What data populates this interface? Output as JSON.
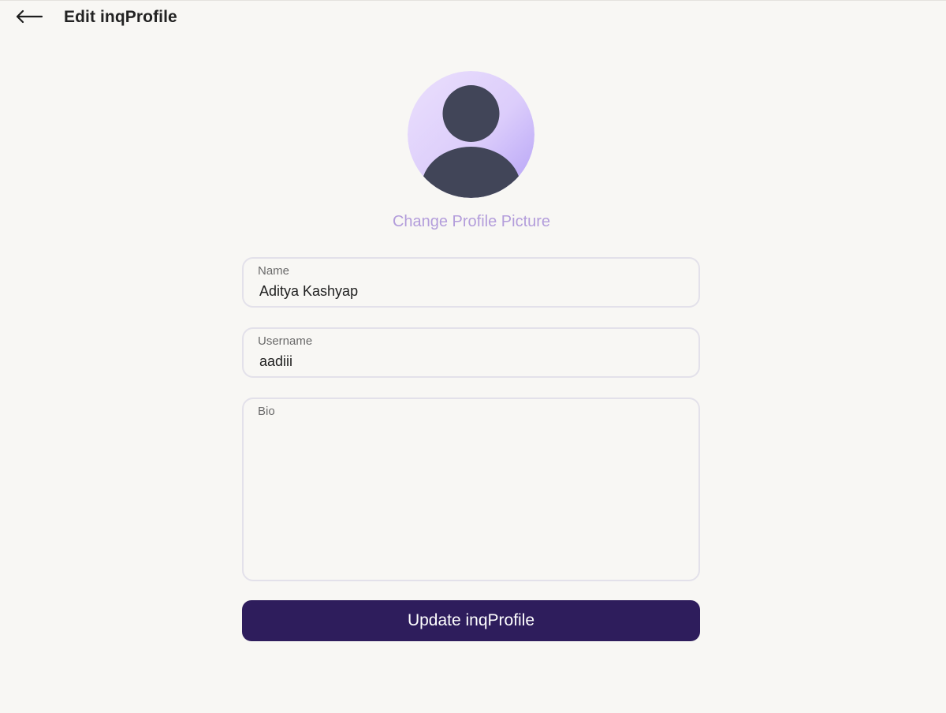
{
  "header": {
    "back_icon": "arrow-left-icon",
    "title": "Edit inqProfile"
  },
  "avatar": {
    "icon": "user-silhouette-icon",
    "gradient_start": "#e6d8fb",
    "gradient_end": "#b9a6f7",
    "silhouette_color": "#414558"
  },
  "change_picture_label": "Change Profile Picture",
  "form": {
    "name": {
      "label": "Name",
      "value": "Aditya Kashyap"
    },
    "username": {
      "label": "Username",
      "value": "aadiii"
    },
    "bio": {
      "label": "Bio",
      "value": ""
    }
  },
  "submit_label": "Update inqProfile",
  "colors": {
    "background": "#f8f7f4",
    "accent_button": "#2e1d5c",
    "link_text": "#b39ddb",
    "field_border": "#e3e1ea"
  }
}
